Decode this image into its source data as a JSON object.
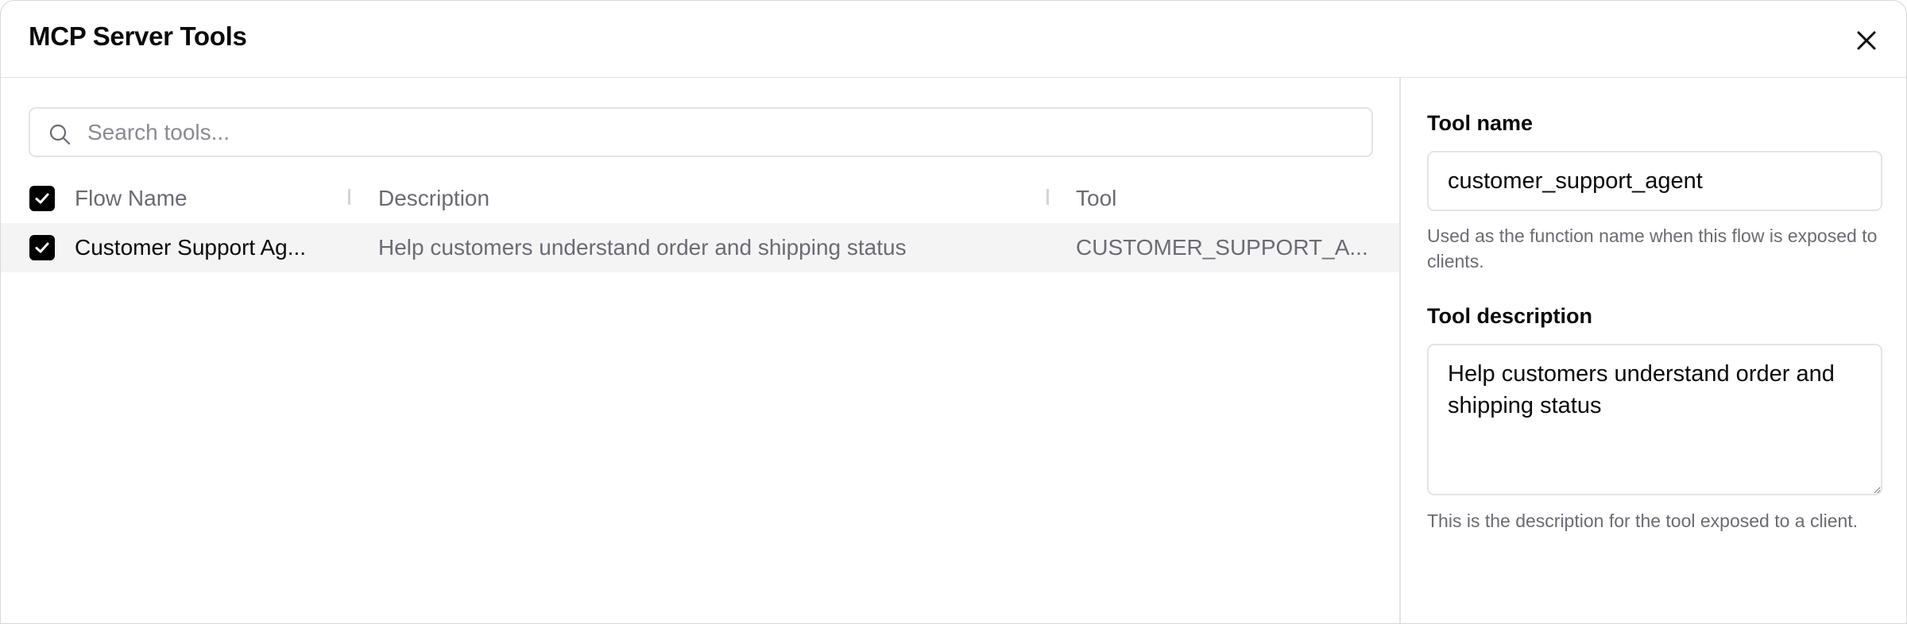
{
  "dialog": {
    "title": "MCP Server Tools",
    "close_icon": "close-icon"
  },
  "search": {
    "placeholder": "Search tools...",
    "value": "",
    "icon": "search-icon"
  },
  "table": {
    "select_all_checked": true,
    "columns": [
      "Flow Name",
      "Description",
      "Tool"
    ],
    "rows": [
      {
        "checked": true,
        "flow_name": "Customer Support Ag...",
        "description": "Help customers understand order and shipping status",
        "tool": "CUSTOMER_SUPPORT_A..."
      }
    ]
  },
  "details": {
    "tool_name_label": "Tool name",
    "tool_name_value": "customer_support_agent",
    "tool_name_help": "Used as the function name when this flow is exposed to clients.",
    "tool_description_label": "Tool description",
    "tool_description_value": "Help customers understand order and shipping status",
    "tool_description_help": "This is the description for the tool exposed to a client."
  },
  "colors": {
    "border": "#e4e4e7",
    "row_selected_bg": "#f4f4f5",
    "muted_text": "#6b6b73",
    "checkbox_fill": "#000000"
  }
}
